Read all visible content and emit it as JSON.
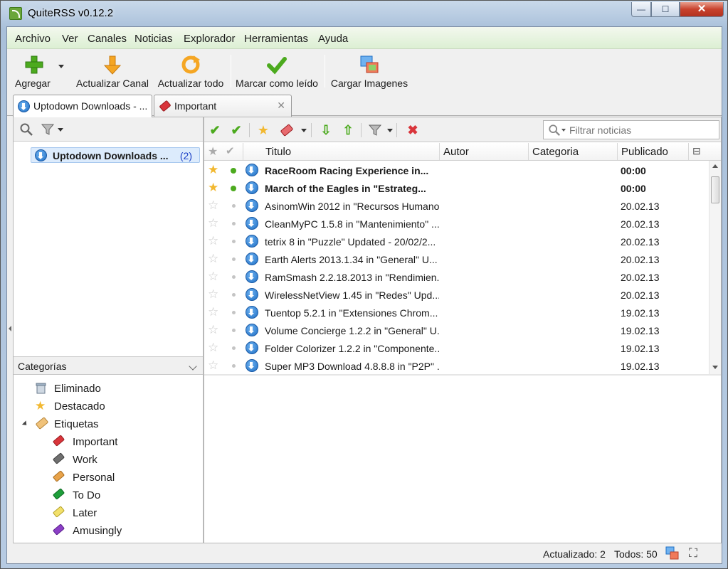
{
  "window": {
    "title": "QuiteRSS v0.12.2",
    "min": "—",
    "max": "☐",
    "close": "✕"
  },
  "menu": [
    "Archivo",
    "Ver",
    "Canales",
    "Noticias",
    "Explorador",
    "Herramientas",
    "Ayuda"
  ],
  "toolbar": {
    "add": "Agregar",
    "update_feed": "Actualizar Canal",
    "update_all": "Actualizar todo",
    "mark_read": "Marcar como leído",
    "load_images": "Cargar Imagenes"
  },
  "tabs": [
    {
      "label": "Uptodown Downloads - ...",
      "icon": "download-icon"
    },
    {
      "label": "Important",
      "icon": "tag-icon",
      "close": "✕"
    }
  ],
  "feeds": [
    {
      "name": "Uptodown Downloads ...",
      "count": "(2)"
    }
  ],
  "categories": {
    "header": "Categorías",
    "items": [
      {
        "label": "Eliminado",
        "icon": "trash-icon"
      },
      {
        "label": "Destacado",
        "icon": "star-icon"
      },
      {
        "label": "Etiquetas",
        "icon": "tag-icon"
      },
      {
        "label": "Important",
        "color": "#d9353b"
      },
      {
        "label": "Work",
        "color": "#6f6f6f"
      },
      {
        "label": "Personal",
        "color": "#e8a34a"
      },
      {
        "label": "To Do",
        "color": "#1e9e3a"
      },
      {
        "label": "Later",
        "color": "#e8d64a"
      },
      {
        "label": "Amusingly",
        "color": "#8b3fc6"
      }
    ]
  },
  "search": {
    "placeholder": "Filtrar noticias"
  },
  "columns": {
    "title": "Titulo",
    "author": "Autor",
    "category": "Categoria",
    "published": "Publicado"
  },
  "news": [
    {
      "title": "RaceRoom Racing Experience in...",
      "date": "00:00",
      "starred": true,
      "unread": true
    },
    {
      "title": "March of the Eagles in \"Estrateg...",
      "date": "00:00",
      "starred": true,
      "unread": true
    },
    {
      "title": "AsinomWin 2012 in \"Recursos Humano...",
      "date": "20.02.13",
      "starred": false,
      "unread": false
    },
    {
      "title": "CleanMyPC 1.5.8 in \"Mantenimiento\" ...",
      "date": "20.02.13",
      "starred": false,
      "unread": false
    },
    {
      "title": "tetrix 8 in \"Puzzle\" Updated - 20/02/2...",
      "date": "20.02.13",
      "starred": false,
      "unread": false
    },
    {
      "title": "Earth Alerts 2013.1.34 in \"General\" U...",
      "date": "20.02.13",
      "starred": false,
      "unread": false
    },
    {
      "title": "RamSmash 2.2.18.2013 in \"Rendimien...",
      "date": "20.02.13",
      "starred": false,
      "unread": false
    },
    {
      "title": "WirelessNetView 1.45 in \"Redes\" Upd...",
      "date": "20.02.13",
      "starred": false,
      "unread": false
    },
    {
      "title": "Tuentop 5.2.1 in \"Extensiones Chrom...",
      "date": "19.02.13",
      "starred": false,
      "unread": false
    },
    {
      "title": "Volume Concierge 1.2.2 in \"General\" U...",
      "date": "19.02.13",
      "starred": false,
      "unread": false
    },
    {
      "title": "Folder Colorizer 1.2.2 in \"Componente...",
      "date": "19.02.13",
      "starred": false,
      "unread": false
    },
    {
      "title": "Super MP3 Download 4.8.8.8 in \"P2P\" ...",
      "date": "19.02.13",
      "starred": false,
      "unread": false
    }
  ],
  "status": {
    "updated": "Actualizado: 2",
    "total": "Todos: 50"
  },
  "colors": {
    "accent": "#dcebfc",
    "menubar": "#dcefd3"
  }
}
